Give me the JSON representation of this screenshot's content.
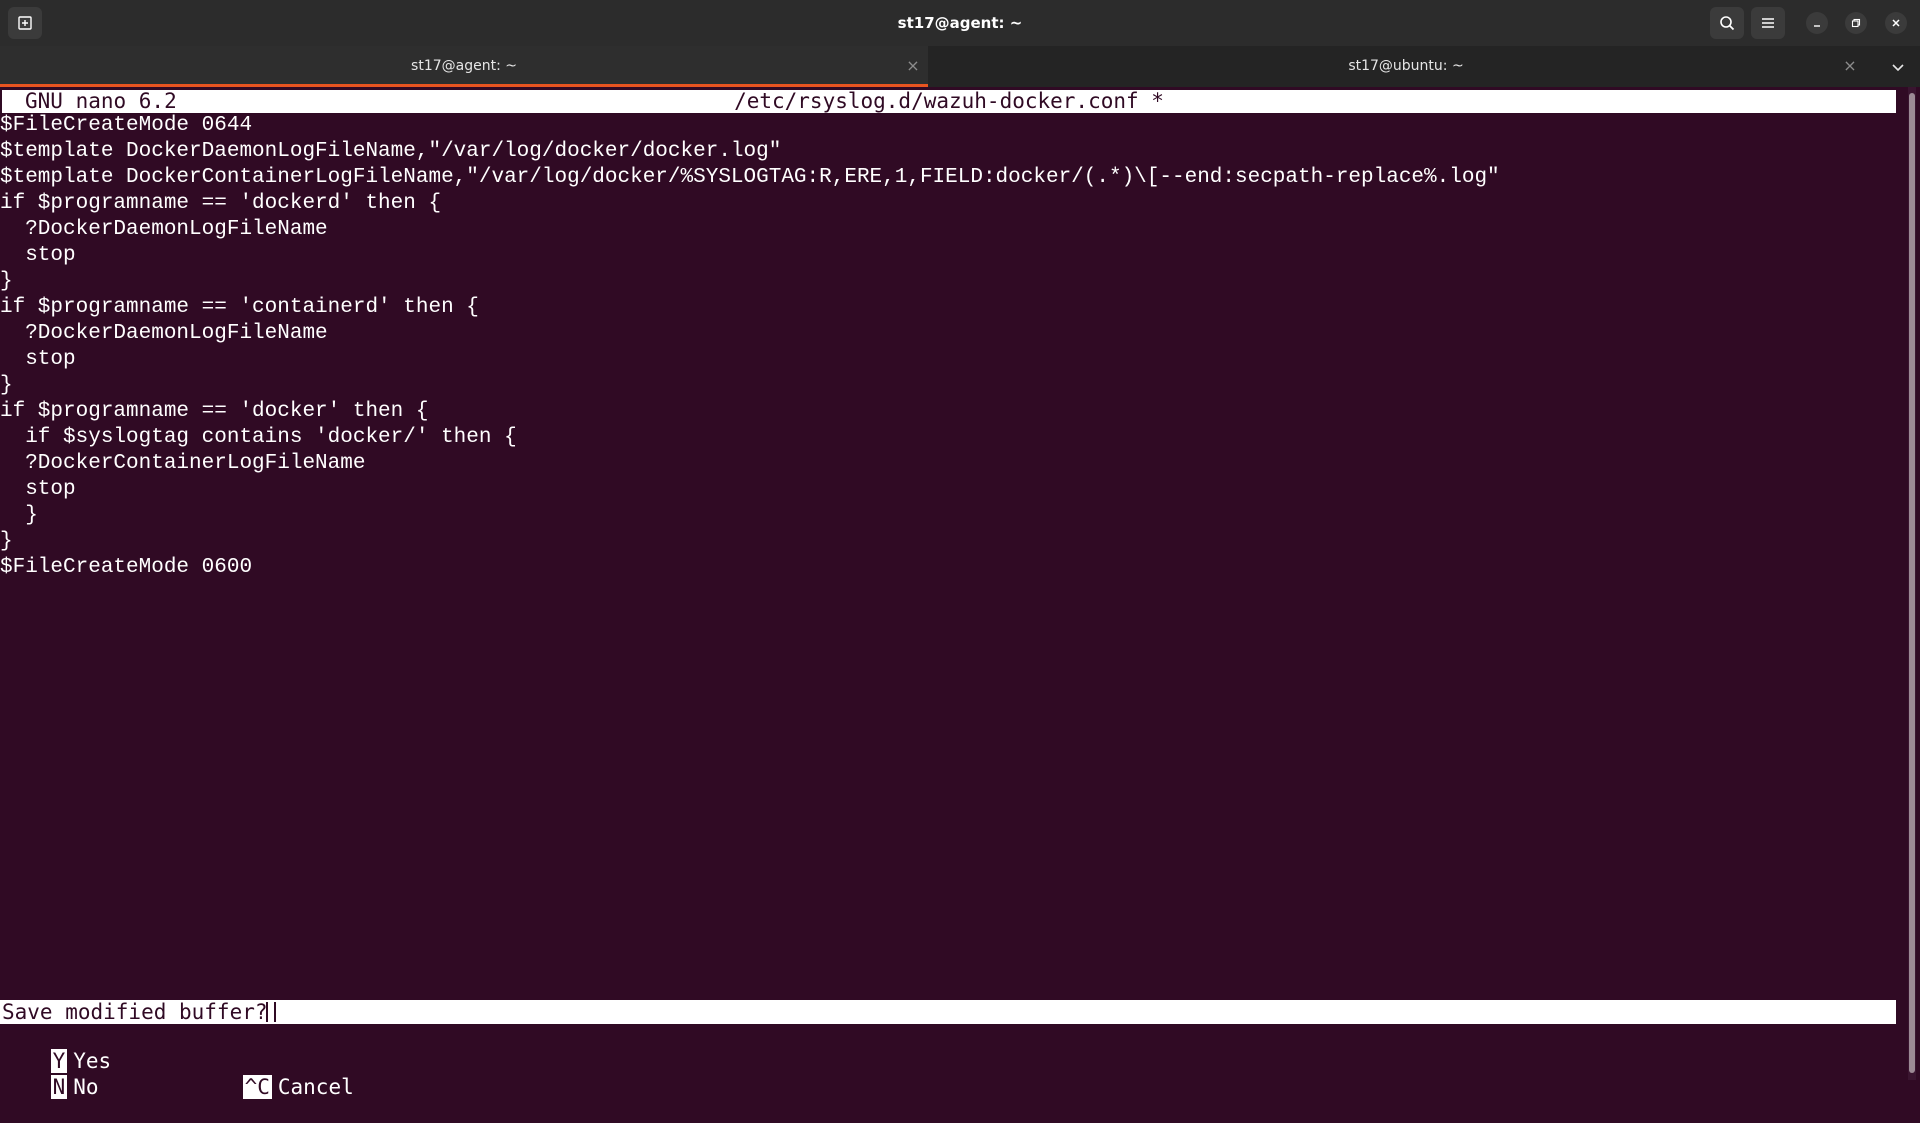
{
  "window": {
    "title": "st17@agent: ~"
  },
  "tabs": [
    {
      "label": "st17@agent: ~",
      "active": true
    },
    {
      "label": "st17@ubuntu: ~",
      "active": false
    }
  ],
  "nano": {
    "version": "GNU nano 6.2",
    "filename": "/etc/rsyslog.d/wazuh-docker.conf *",
    "lines": [
      "$FileCreateMode 0644",
      "$template DockerDaemonLogFileName,\"/var/log/docker/docker.log\"",
      "$template DockerContainerLogFileName,\"/var/log/docker/%SYSLOGTAG:R,ERE,1,FIELD:docker/(.*)\\[--end:secpath-replace%.log\"",
      "if $programname == 'dockerd' then {",
      "  ?DockerDaemonLogFileName",
      "  stop",
      "}",
      "if $programname == 'containerd' then {",
      "  ?DockerDaemonLogFileName",
      "  stop",
      "}",
      "if $programname == 'docker' then {",
      "  if $syslogtag contains 'docker/' then {",
      "  ?DockerContainerLogFileName",
      "  stop",
      "  }",
      "}",
      "$FileCreateMode 0600"
    ],
    "prompt": "Save modified buffer?",
    "options": {
      "yes_key": "Y",
      "yes_label": "Yes",
      "no_key": "N",
      "no_label": "No",
      "cancel_key": "^C",
      "cancel_label": "Cancel"
    }
  },
  "colors": {
    "terminal_bg": "#300a24",
    "accent": "#e95420"
  },
  "icons": [
    "new-tab-icon",
    "search-icon",
    "hamburger-menu-icon",
    "minimize-icon",
    "maximize-icon",
    "close-icon",
    "tab-close-icon",
    "tab-list-chevron-icon"
  ]
}
